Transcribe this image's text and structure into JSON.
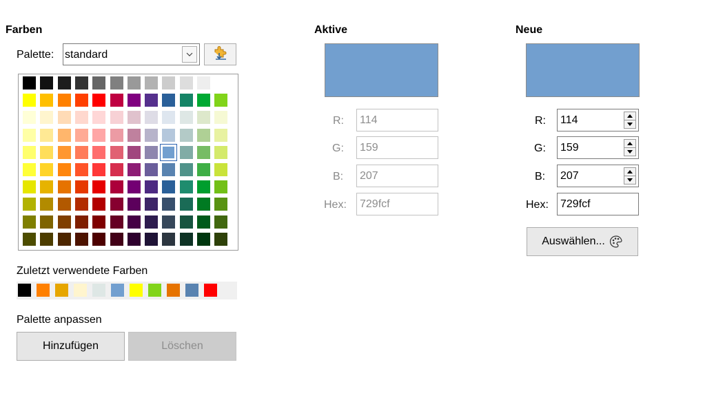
{
  "farben": {
    "heading": "Farben",
    "palette_label": "Palette:",
    "palette_value": "standard",
    "grid": [
      [
        "#000000",
        "#111111",
        "#1c1c1c",
        "#333333",
        "#666666",
        "#808080",
        "#999999",
        "#b2b2b2",
        "#cccccc",
        "#dddddd",
        "#eeeeee",
        "#ffffff"
      ],
      [
        "#ffff00",
        "#ffbf00",
        "#ff8000",
        "#ff4000",
        "#ff0000",
        "#bf0041",
        "#800080",
        "#55308d",
        "#2a6099",
        "#158466",
        "#00a933",
        "#81d41a"
      ],
      [
        "#ffffd7",
        "#fff5ce",
        "#ffdbb6",
        "#ffd8ce",
        "#ffd7d7",
        "#f7d1d5",
        "#e0c2cd",
        "#dedce6",
        "#dee6ef",
        "#dee7e5",
        "#dde8cb",
        "#f6f9d4"
      ],
      [
        "#ffffa6",
        "#ffe994",
        "#ffb66c",
        "#ffaa95",
        "#ffa6a6",
        "#ec9ba4",
        "#bf819e",
        "#b7b3ca",
        "#b4c7dc",
        "#b3cac7",
        "#afd095",
        "#e8f2a1"
      ],
      [
        "#ffff6d",
        "#ffde59",
        "#ff972f",
        "#ff7b59",
        "#ff6d6d",
        "#e16173",
        "#a1467e",
        "#8e86ae",
        "#729fcf",
        "#81aca6",
        "#77bc65",
        "#d4ea6b"
      ],
      [
        "#ffff38",
        "#ffd428",
        "#ff860d",
        "#ff5429",
        "#ff3838",
        "#d62e4e",
        "#8d1d75",
        "#6b5e9b",
        "#5983b0",
        "#50938a",
        "#3faf46",
        "#c9e33b"
      ],
      [
        "#e6e600",
        "#e6b300",
        "#e67300",
        "#e63900",
        "#e60000",
        "#ac003a",
        "#730073",
        "#4d2a82",
        "#2a6099",
        "#1e8c6e",
        "#009e2e",
        "#72c017"
      ],
      [
        "#b2b200",
        "#b28b00",
        "#b25900",
        "#b22c00",
        "#b20000",
        "#870030",
        "#5c005c",
        "#3d2568",
        "#374f6c",
        "#1a6b56",
        "#007a22",
        "#589312"
      ],
      [
        "#7f7f00",
        "#7f6400",
        "#7f3f00",
        "#7f1f00",
        "#7f0000",
        "#660024",
        "#450045",
        "#2e1c4f",
        "#36475a",
        "#17543f",
        "#005a1a",
        "#41680f"
      ],
      [
        "#4d4d00",
        "#4d3d00",
        "#4d2600",
        "#4d1300",
        "#4d0000",
        "#420017",
        "#2e002e",
        "#1f1336",
        "#2c3640",
        "#0e3325",
        "#00370f",
        "#2e4109"
      ]
    ],
    "selected": {
      "row": 4,
      "col": 8
    },
    "recent_label": "Zuletzt verwendete Farben",
    "recent_colors": [
      "#000000",
      "#ff8000",
      "#e6a600",
      "#fff5ce",
      "#dee7e5",
      "#729fcf",
      "#ffff00",
      "#81d41a",
      "#e67300",
      "#5983b0",
      "#ff0000"
    ],
    "customize_label": "Palette anpassen",
    "add_label": "Hinzufügen",
    "delete_label": "Löschen"
  },
  "active": {
    "heading": "Aktive",
    "color": "#729fcf",
    "r_label": "R:",
    "r": "114",
    "g_label": "G:",
    "g": "159",
    "b_label": "B:",
    "b": "207",
    "hex_label": "Hex:",
    "hex": "729fcf"
  },
  "new": {
    "heading": "Neue",
    "color": "#729fcf",
    "r_label": "R:",
    "r": "114",
    "g_label": "G:",
    "g": "159",
    "b_label": "B:",
    "b": "207",
    "hex_label": "Hex:",
    "hex": "729fcf",
    "pick_label": "Auswählen..."
  }
}
